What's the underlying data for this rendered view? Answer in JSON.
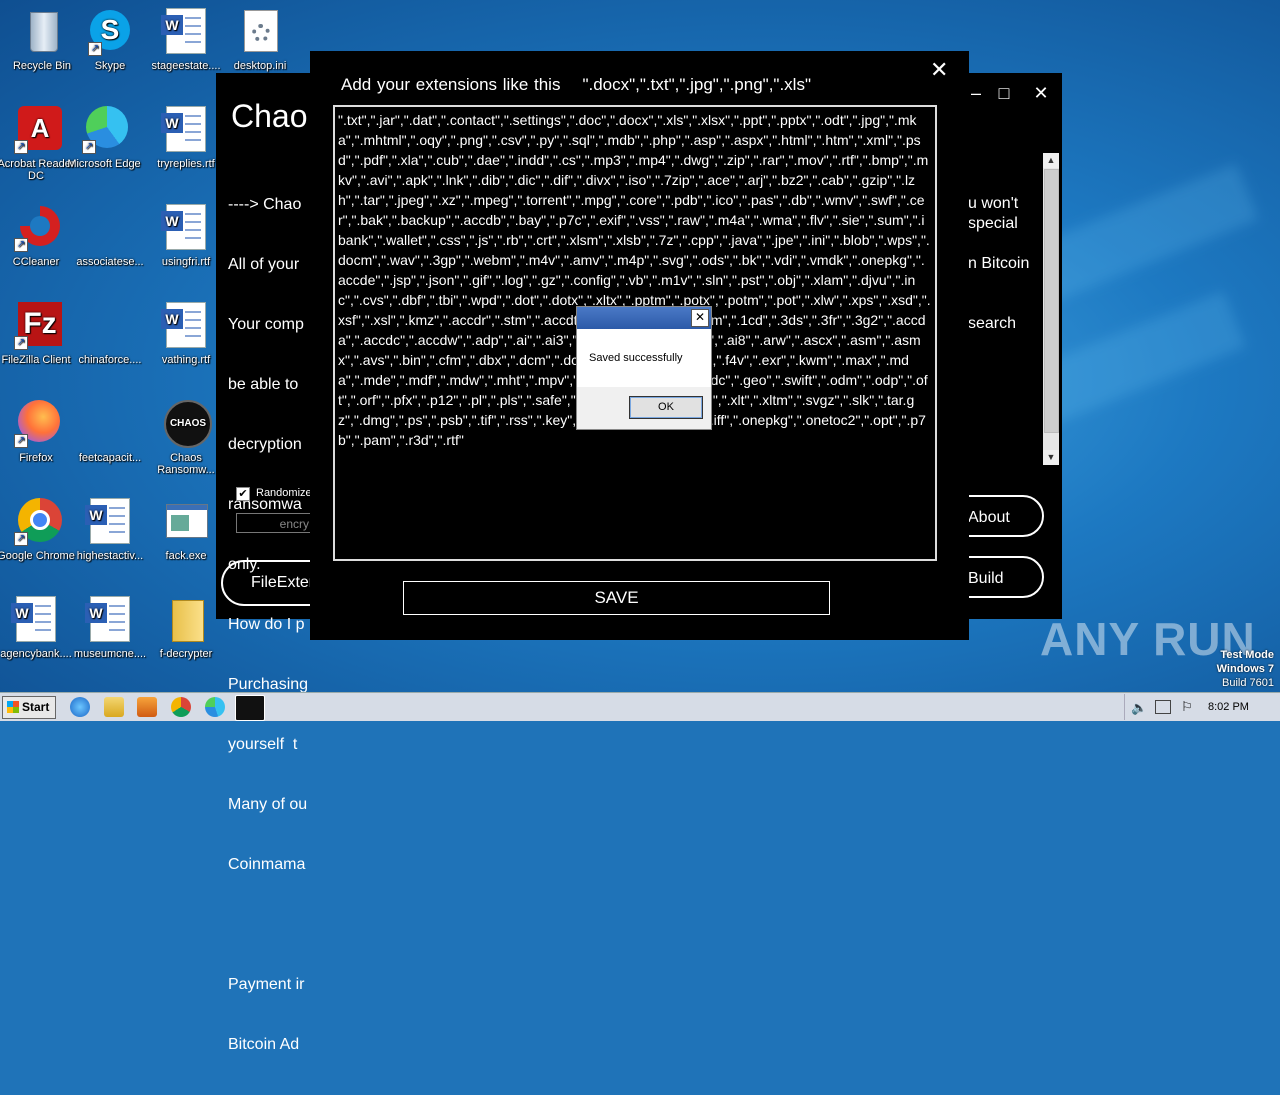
{
  "desktop": {
    "icons": [
      {
        "label": "Recycle Bin"
      },
      {
        "label": "Skype"
      },
      {
        "label": "stageestate...."
      },
      {
        "label": "desktop.ini"
      },
      {
        "label": "Acrobat Reader DC"
      },
      {
        "label": "Microsoft Edge"
      },
      {
        "label": "tryreplies.rtf"
      },
      {
        "label": "CCleaner"
      },
      {
        "label": "associatese..."
      },
      {
        "label": "usingfri.rtf"
      },
      {
        "label": "FileZilla Client"
      },
      {
        "label": "chinaforce...."
      },
      {
        "label": "vathing.rtf"
      },
      {
        "label": "Firefox"
      },
      {
        "label": "feetcapacit..."
      },
      {
        "label": "Chaos Ransomw..."
      },
      {
        "label": "Google Chrome"
      },
      {
        "label": "highestactiv..."
      },
      {
        "label": "fack.exe"
      },
      {
        "label": "agencybank...."
      },
      {
        "label": "museumcne...."
      },
      {
        "label": "f-decrypter"
      }
    ],
    "watermark": "ANY RUN",
    "test_mode": [
      "Test Mode",
      "Windows 7",
      "Build 7601"
    ]
  },
  "chaos_window": {
    "title_big": "Chao",
    "body_lines": [
      "----> Chao",
      "All of your",
      "Your comp",
      "be able to",
      "decryption",
      "ransomwa",
      "only.",
      "How do I p",
      "Purchasing",
      "yourself  t",
      "Many of ou",
      "Coinmama",
      "",
      "Payment ir",
      "Bitcoin Ad"
    ],
    "right_lines": [
      "u won't",
      " special",
      "n Bitcoin",
      "search"
    ],
    "randomize_label": "Randomize",
    "encrypt_placeholder": "encry",
    "file_ext_button": "FileExter",
    "about_button": "About",
    "build_button": "Build"
  },
  "extensions_dialog": {
    "header_label": "Add your extensions like this",
    "header_example": "\".docx\",\".txt\",\".jpg\",\".png\",\".xls\"",
    "close_glyph": "✕",
    "text_content": "\".txt\",\".jar\",\".dat\",\".contact\",\".settings\",\".doc\",\".docx\",\".xls\",\".xlsx\",\".ppt\",\".pptx\",\".odt\",\".jpg\",\".mka\",\".mhtml\",\".oqy\",\".png\",\".csv\",\".py\",\".sql\",\".mdb\",\".php\",\".asp\",\".aspx\",\".html\",\".htm\",\".xml\",\".psd\",\".pdf\",\".xla\",\".cub\",\".dae\",\".indd\",\".cs\",\".mp3\",\".mp4\",\".dwg\",\".zip\",\".rar\",\".mov\",\".rtf\",\".bmp\",\".mkv\",\".avi\",\".apk\",\".lnk\",\".dib\",\".dic\",\".dif\",\".divx\",\".iso\",\".7zip\",\".ace\",\".arj\",\".bz2\",\".cab\",\".gzip\",\".lzh\",\".tar\",\".jpeg\",\".xz\",\".mpeg\",\".torrent\",\".mpg\",\".core\",\".pdb\",\".ico\",\".pas\",\".db\",\".wmv\",\".swf\",\".cer\",\".bak\",\".backup\",\".accdb\",\".bay\",\".p7c\",\".exif\",\".vss\",\".raw\",\".m4a\",\".wma\",\".flv\",\".sie\",\".sum\",\".ibank\",\".wallet\",\".css\",\".js\",\".rb\",\".crt\",\".xlsm\",\".xlsb\",\".7z\",\".cpp\",\".java\",\".jpe\",\".ini\",\".blob\",\".wps\",\".docm\",\".wav\",\".3gp\",\".webm\",\".m4v\",\".amv\",\".m4p\",\".svg\",\".ods\",\".bk\",\".vdi\",\".vmdk\",\".onepkg\",\".accde\",\".jsp\",\".json\",\".gif\",\".log\",\".gz\",\".config\",\".vb\",\".m1v\",\".sln\",\".pst\",\".obj\",\".xlam\",\".djvu\",\".inc\",\".cvs\",\".dbf\",\".tbi\",\".wpd\",\".dot\",\".dotx\",\".xltx\",\".pptm\",\".potx\",\".potm\",\".pot\",\".xlw\",\".xps\",\".xsd\",\".xsf\",\".xsl\",\".kmz\",\".accdr\",\".stm\",\".accdt\",\".ppam\",\".pps\",\".ppsm\",\".1cd\",\".3ds\",\".3fr\",\".3g2\",\".accda\",\".accdc\",\".accdw\",\".adp\",\".ai\",\".ai3\",\".ai4\",\".ai5\",\".ai6\",\".ai7\",\".ai8\",\".arw\",\".ascx\",\".asm\",\".asmx\",\".avs\",\".bin\",\".cfm\",\".dbx\",\".dcm\",\".dcr\",\".pict\",\".rgbe\",\".dwt\",\".f4v\",\".exr\",\".kwm\",\".max\",\".mda\",\".mde\",\".mdf\",\".mdw\",\".mht\",\".mpv\",\".msg\",\".myi\",\".nef\",\".odc\",\".geo\",\".swift\",\".odm\",\".odp\",\".oft\",\".orf\",\".pfx\",\".p12\",\".pl\",\".pls\",\".safe\",\".tab\",\".vbs\",\".xlk\",\".xlm\",\".xlt\",\".xltm\",\".svgz\",\".slk\",\".tar.gz\",\".dmg\",\".ps\",\".psb\",\".tif\",\".rss\",\".key\",\".vob\",\".epsp\",\".dc3\",\".iff\",\".onepkg\",\".onetoc2\",\".opt\",\".p7b\",\".pam\",\".r3d\",\".rtf\"",
    "save_button": "SAVE"
  },
  "message_box": {
    "text": "Saved successfully",
    "ok_button": "OK"
  },
  "taskbar": {
    "start_label": "Start",
    "clock": "8:02 PM"
  }
}
